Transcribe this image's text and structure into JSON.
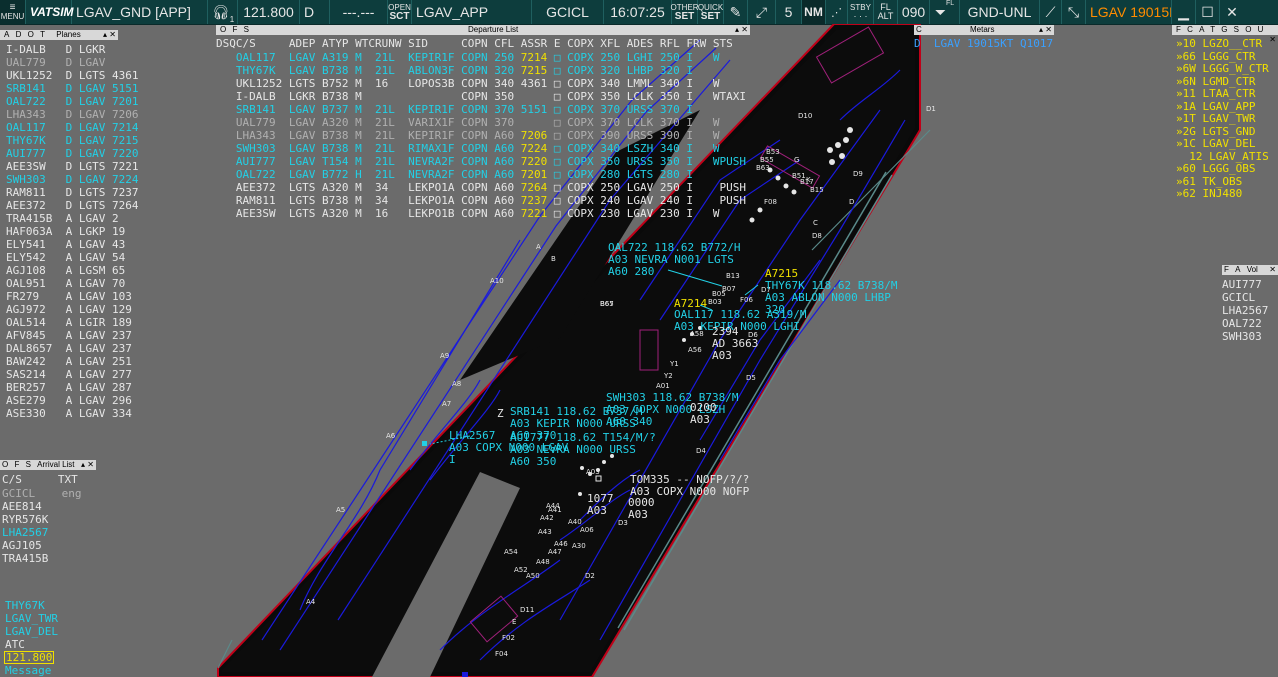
{
  "topbar": {
    "menu_label": "MENU",
    "brand": "VATSIM",
    "callsign": "LGAV_GND [APP]",
    "headset_index": "1",
    "primary_freq": "121.800",
    "atis_code": "D",
    "secondary_freq": "---.---",
    "open_sct_top": "OPEN",
    "open_sct_bottom": "SCT",
    "sector": "LGAV_APP",
    "selected_callsign": "GCICL",
    "clock": "16:07:25",
    "other_set_top": "OTHER",
    "other_set_bottom": "SET",
    "quick_set_top": "QUICK",
    "quick_set_bottom": "SET",
    "range_value": "5",
    "range_unit": "NM",
    "stby_label": "STBY",
    "fl_top": "FL",
    "fl_bottom": "ALT",
    "transition_level": "090",
    "fl_mini": "FL",
    "gnd_unl": "GND-UNL",
    "metar_ticker": "LGAV 19015K",
    "colors": {
      "bar": "#0d3d3d",
      "ticker": "#ff8c00"
    }
  },
  "planes_panel": {
    "title": "Planes",
    "tabs": [
      "A",
      "D",
      "O",
      "T"
    ],
    "rows": [
      {
        "cs": "I-DALB",
        "t": "D",
        "apt": "LGKR",
        "n": "",
        "c": "white"
      },
      {
        "cs": "UAL779",
        "t": "D",
        "apt": "LGAV",
        "n": "",
        "c": "grey"
      },
      {
        "cs": "UKL1252",
        "t": "D",
        "apt": "LGTS",
        "n": "4361",
        "c": "white"
      },
      {
        "cs": "SRB141",
        "t": "D",
        "apt": "LGAV",
        "n": "5151",
        "c": "cyan"
      },
      {
        "cs": "OAL722",
        "t": "D",
        "apt": "LGAV",
        "n": "7201",
        "c": "cyan"
      },
      {
        "cs": "LHA343",
        "t": "D",
        "apt": "LGAV",
        "n": "7206",
        "c": "grey"
      },
      {
        "cs": "OAL117",
        "t": "D",
        "apt": "LGAV",
        "n": "7214",
        "c": "cyan"
      },
      {
        "cs": "THY67K",
        "t": "D",
        "apt": "LGAV",
        "n": "7215",
        "c": "cyan"
      },
      {
        "cs": "AUI777",
        "t": "D",
        "apt": "LGAV",
        "n": "7220",
        "c": "cyan"
      },
      {
        "cs": "AEE3SW",
        "t": "D",
        "apt": "LGTS",
        "n": "7221",
        "c": "white"
      },
      {
        "cs": "SWH303",
        "t": "D",
        "apt": "LGAV",
        "n": "7224",
        "c": "cyan"
      },
      {
        "cs": "RAM811",
        "t": "D",
        "apt": "LGTS",
        "n": "7237",
        "c": "white"
      },
      {
        "cs": "AEE372",
        "t": "D",
        "apt": "LGTS",
        "n": "7264",
        "c": "white"
      },
      {
        "cs": "TRA415B",
        "t": "A",
        "apt": "LGAV",
        "n": "2",
        "c": "white"
      },
      {
        "cs": "HAF063A",
        "t": "A",
        "apt": "LGKP",
        "n": "19",
        "c": "white"
      },
      {
        "cs": "ELY541",
        "t": "A",
        "apt": "LGAV",
        "n": "43",
        "c": "white"
      },
      {
        "cs": "ELY542",
        "t": "A",
        "apt": "LGAV",
        "n": "54",
        "c": "white"
      },
      {
        "cs": "AGJ108",
        "t": "A",
        "apt": "LGSM",
        "n": "65",
        "c": "white"
      },
      {
        "cs": "OAL951",
        "t": "A",
        "apt": "LGAV",
        "n": "70",
        "c": "white"
      },
      {
        "cs": "FR279",
        "t": "A",
        "apt": "LGAV",
        "n": "103",
        "c": "white"
      },
      {
        "cs": "AGJ972",
        "t": "A",
        "apt": "LGAV",
        "n": "129",
        "c": "white"
      },
      {
        "cs": "OAL514",
        "t": "A",
        "apt": "LGIR",
        "n": "189",
        "c": "white"
      },
      {
        "cs": "AFV845",
        "t": "A",
        "apt": "LGAV",
        "n": "237",
        "c": "white"
      },
      {
        "cs": "DAL8657",
        "t": "A",
        "apt": "LGAV",
        "n": "237",
        "c": "white"
      },
      {
        "cs": "BAW242",
        "t": "A",
        "apt": "LGAV",
        "n": "251",
        "c": "white"
      },
      {
        "cs": "SAS214",
        "t": "A",
        "apt": "LGAV",
        "n": "277",
        "c": "white"
      },
      {
        "cs": "BER257",
        "t": "A",
        "apt": "LGAV",
        "n": "287",
        "c": "white"
      },
      {
        "cs": "ASE279",
        "t": "A",
        "apt": "LGAV",
        "n": "296",
        "c": "white"
      },
      {
        "cs": "ASE330",
        "t": "A",
        "apt": "LGAV",
        "n": "334",
        "c": "white"
      }
    ]
  },
  "departure_list": {
    "title": "Departure List",
    "tabs": [
      "O",
      "F",
      "S"
    ],
    "columns": [
      "DSQ",
      "C/S",
      "ADEP",
      "ATYP",
      "WTC",
      "RUNW",
      "SID",
      "COPN",
      "CFL",
      "ASSR",
      "E",
      "COPX",
      "XFL",
      "ADES",
      "RFL",
      "FRW",
      "STS"
    ],
    "rows": [
      {
        "c": "cyan",
        "cs": "OAL117",
        "adep": "LGAV",
        "atyp": "A319",
        "wtc": "M",
        "rw": "21L",
        "sid": "KEPIR1F",
        "copn": "COPN",
        "cfl": "250",
        "assr": "7214",
        "copx": "COPX",
        "xfl": "250",
        "ades": "LGHI",
        "rfl": "250",
        "frw": "I",
        "sts": "W"
      },
      {
        "c": "cyan",
        "cs": "THY67K",
        "adep": "LGAV",
        "atyp": "B738",
        "wtc": "M",
        "rw": "21L",
        "sid": "ABLON3F",
        "copn": "COPN",
        "cfl": "320",
        "assr": "7215",
        "copx": "COPX",
        "xfl": "320",
        "ades": "LHBP",
        "rfl": "320",
        "frw": "I",
        "sts": ""
      },
      {
        "c": "white",
        "cs": "UKL1252",
        "adep": "LGTS",
        "atyp": "B752",
        "wtc": "M",
        "rw": "16",
        "sid": "LOPOS3B",
        "copn": "COPN",
        "cfl": "340",
        "assr": "4361",
        "copx": "COPX",
        "xfl": "340",
        "ades": "LMML",
        "rfl": "340",
        "frw": "I",
        "sts": "W"
      },
      {
        "c": "white",
        "cs": "I-DALB",
        "adep": "LGKR",
        "atyp": "B738",
        "wtc": "M",
        "rw": "",
        "sid": "",
        "copn": "COPN",
        "cfl": "350",
        "assr": "",
        "copx": "COPX",
        "xfl": "350",
        "ades": "LCLK",
        "rfl": "350",
        "frw": "I",
        "sts": "WTAXI"
      },
      {
        "c": "cyan",
        "cs": "SRB141",
        "adep": "LGAV",
        "atyp": "B737",
        "wtc": "M",
        "rw": "21L",
        "sid": "KEPIR1F",
        "copn": "COPN",
        "cfl": "370",
        "assr": "5151",
        "copx": "COPX",
        "xfl": "370",
        "ades": "URSS",
        "rfl": "370",
        "frw": "I",
        "sts": ""
      },
      {
        "c": "grey",
        "cs": "UAL779",
        "adep": "LGAV",
        "atyp": "A320",
        "wtc": "M",
        "rw": "21L",
        "sid": "VARIX1F",
        "copn": "COPN",
        "cfl": "370",
        "assr": "",
        "copx": "COPX",
        "xfl": "370",
        "ades": "LCLK",
        "rfl": "370",
        "frw": "I",
        "sts": "W"
      },
      {
        "c": "grey",
        "cs": "LHA343",
        "adep": "LGAV",
        "atyp": "B738",
        "wtc": "M",
        "rw": "21L",
        "sid": "KEPIR1F",
        "copn": "COPN",
        "cfl": "A60",
        "assr": "7206",
        "copx": "COPX",
        "xfl": "390",
        "ades": "URSS",
        "rfl": "390",
        "frw": "I",
        "sts": "W"
      },
      {
        "c": "cyan",
        "cs": "SWH303",
        "adep": "LGAV",
        "atyp": "B738",
        "wtc": "M",
        "rw": "21L",
        "sid": "RIMAX1F",
        "copn": "COPN",
        "cfl": "A60",
        "assr": "7224",
        "copx": "COPX",
        "xfl": "340",
        "ades": "LSZH",
        "rfl": "340",
        "frw": "I",
        "sts": "W"
      },
      {
        "c": "cyan",
        "cs": "AUI777",
        "adep": "LGAV",
        "atyp": "T154",
        "wtc": "M",
        "rw": "21L",
        "sid": "NEVRA2F",
        "copn": "COPN",
        "cfl": "A60",
        "assr": "7220",
        "copx": "COPX",
        "xfl": "350",
        "ades": "URSS",
        "rfl": "350",
        "frw": "I",
        "sts": "WPUSH"
      },
      {
        "c": "cyan",
        "cs": "OAL722",
        "adep": "LGAV",
        "atyp": "B772",
        "wtc": "H",
        "rw": "21L",
        "sid": "NEVRA2F",
        "copn": "COPN",
        "cfl": "A60",
        "assr": "7201",
        "copx": "COPX",
        "xfl": "280",
        "ades": "LGTS",
        "rfl": "280",
        "frw": "I",
        "sts": ""
      },
      {
        "c": "white",
        "cs": "AEE372",
        "adep": "LGTS",
        "atyp": "A320",
        "wtc": "M",
        "rw": "34",
        "sid": "LEKPO1A",
        "copn": "COPN",
        "cfl": "A60",
        "assr": "7264",
        "copx": "COPX",
        "xfl": "250",
        "ades": "LGAV",
        "rfl": "250",
        "frw": "I",
        "sts": " PUSH"
      },
      {
        "c": "white",
        "cs": "RAM811",
        "adep": "LGTS",
        "atyp": "B738",
        "wtc": "M",
        "rw": "34",
        "sid": "LEKPO1A",
        "copn": "COPN",
        "cfl": "A60",
        "assr": "7237",
        "copx": "COPX",
        "xfl": "240",
        "ades": "LGAV",
        "rfl": "240",
        "frw": "I",
        "sts": " PUSH"
      },
      {
        "c": "white",
        "cs": "AEE3SW",
        "adep": "LGTS",
        "atyp": "A320",
        "wtc": "M",
        "rw": "16",
        "sid": "LEKPO1B",
        "copn": "COPN",
        "cfl": "A60",
        "assr": "7221",
        "copx": "COPX",
        "xfl": "230",
        "ades": "LGAV",
        "rfl": "230",
        "frw": "I",
        "sts": "W"
      }
    ]
  },
  "metars_panel": {
    "title": "Metars",
    "line": "D  LGAV 19015KT Q1017"
  },
  "atc_panel": {
    "tabs": [
      "F",
      "C",
      "A",
      "T",
      "G",
      "S",
      "O",
      "U"
    ],
    "rows": [
      "»10 LGZO__CTR",
      "»66 LGGG_CTR",
      "»6W LGGG_W_CTR",
      "»6N LGMD_CTR",
      "»11 LTAA_CTR",
      "»1A LGAV_APP",
      "»1T LGAV_TWR",
      "»2G LGTS_GND",
      "»1C LGAV_DEL",
      "  12 LGAV_ATIS",
      "»60 LGGG_OBS",
      "»61 TK_OBS",
      "»62 INJ480"
    ]
  },
  "vol_panel": {
    "title": "Vol",
    "tabs": [
      "F",
      "A"
    ],
    "rows": [
      "AUI777",
      "GCICL",
      "LHA2567",
      "OAL722",
      "SWH303"
    ]
  },
  "arrival_list": {
    "title": "Arrival List",
    "tabs": [
      "O",
      "F",
      "S"
    ],
    "col_cs": "C/S",
    "col_txt": "TXT",
    "rows": [
      {
        "cs": "GCICL",
        "txt": "eng",
        "c": "grey"
      },
      {
        "cs": "AEE814",
        "txt": "",
        "c": "white"
      },
      {
        "cs": "RYR576K",
        "txt": "",
        "c": "white"
      },
      {
        "cs": "LHA2567",
        "txt": "",
        "c": "cyan"
      },
      {
        "cs": "AGJ105",
        "txt": "",
        "c": "white"
      },
      {
        "cs": "TRA415B",
        "txt": "",
        "c": "white"
      }
    ]
  },
  "message_panel": {
    "rows": [
      {
        "t": "THY67K",
        "c": "cyan"
      },
      {
        "t": "LGAV_TWR",
        "c": "cyan"
      },
      {
        "t": "LGAV_DEL",
        "c": "cyan"
      },
      {
        "t": "ATC",
        "c": "white"
      }
    ],
    "freq": "121.800",
    "message_label": "Message"
  },
  "map": {
    "taxiway_labels": [
      "A10",
      "A9",
      "A8",
      "A7",
      "A6",
      "A5",
      "A4",
      "A",
      "B",
      "C",
      "D",
      "D1",
      "D2",
      "D3",
      "D4",
      "D5",
      "D6",
      "D7",
      "D8",
      "D9",
      "D10",
      "D11",
      "E",
      "F02",
      "F04",
      "F06",
      "F08",
      "G",
      "K",
      "Y1",
      "Y2",
      "A01",
      "A03",
      "A06",
      "A30",
      "A40",
      "A41",
      "A42",
      "A43",
      "A44",
      "A46",
      "A47",
      "A48",
      "A50",
      "A52",
      "A54",
      "A56",
      "A58",
      "B03",
      "B05",
      "B07",
      "B13",
      "B15",
      "B17",
      "B51",
      "B53",
      "B55",
      "B63",
      "B65",
      "B67"
    ],
    "tags": [
      {
        "l1": "OAL722 118.62 B772/H",
        "l2": "A03 NEVRA N001 LGTS",
        "l3": "A60 280",
        "c": "cyan"
      },
      {
        "l1": "A7215",
        "l2": "",
        "l3": "",
        "c": "yellow"
      },
      {
        "l1": "THY67K 118.62 B738/M",
        "l2": "A03 ABLON N000 LHBP",
        "l3": "320",
        "c": "cyan"
      },
      {
        "l1": "A7214",
        "l2": "",
        "l3": "",
        "c": "yellow"
      },
      {
        "l1": "OAL117 118.62 A319/M",
        "l2": "A03 KEPIR N000 LGHI",
        "l3": "",
        "c": "cyan"
      },
      {
        "l1": "2394",
        "l2": "AD 3663",
        "l3": "A03",
        "c": "white"
      },
      {
        "l1": "SWH303 118.62 B738/M",
        "l2": "A03 COPX N000 LSZH",
        "l3": "A60 340",
        "c": "cyan"
      },
      {
        "l1": "0200",
        "l2": "A03",
        "l3": "",
        "c": "white"
      },
      {
        "l1": "SRB141 118.62 B737/M",
        "l2": "A03 KEPIR N000 URSS",
        "l3": "A60 370",
        "c": "cyan"
      },
      {
        "l1": "AUI777 118.62 T154/M/?",
        "l2": "A03 NEVRA N000 URSS",
        "l3": "A60 350",
        "c": "cyan"
      },
      {
        "l1": "LHA2567",
        "l2": "A03 COPX N000 LGAV",
        "l3": "I",
        "c": "cyan"
      },
      {
        "l1": "TOM335 -- NOFP/?/?",
        "l2": "A03 COPX N000 NOFP",
        "l3": "",
        "c": "white"
      },
      {
        "l1": "1077",
        "l2": "A03",
        "l3": "",
        "c": "white"
      },
      {
        "l1": "0000",
        "l2": "A03",
        "l3": "",
        "c": "white"
      },
      {
        "l1": "Z",
        "l2": "",
        "l3": "",
        "c": "white"
      }
    ],
    "colors": {
      "ground": "#6b6b6b",
      "runway": "#0c0c0c",
      "border": "#c00018",
      "taxi": "#1a1adc",
      "apron": "#101010"
    }
  }
}
